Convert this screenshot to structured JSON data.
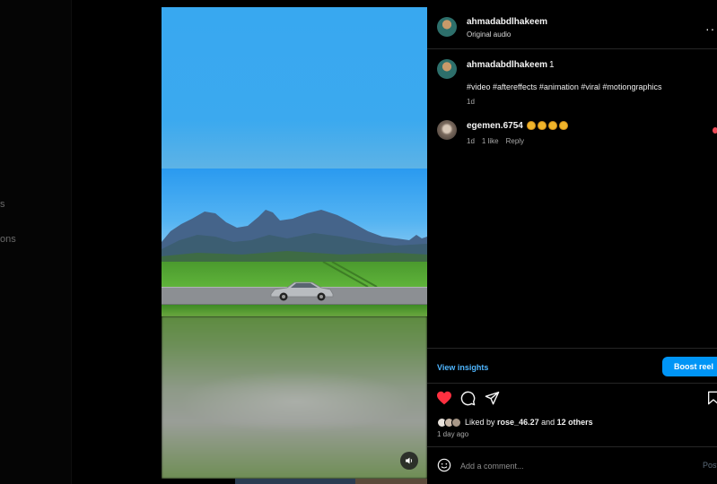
{
  "background": {
    "sidebar_fragments": [
      "s",
      "ons"
    ]
  },
  "video": {
    "mute_icon": "speaker-icon"
  },
  "post": {
    "author": "ahmadabdlhakeem",
    "audio": "Original audio",
    "more_icon": "more-horizontal-icon"
  },
  "caption": {
    "username": "ahmadabdlhakeem",
    "number": "1",
    "text": "#video #aftereffects #animation #viral #motiongraphics",
    "time": "1d"
  },
  "comment": {
    "username": "egemen.6754",
    "emoji": "clapping-hands x4",
    "time": "1d",
    "likes": "1 like",
    "reply": "Reply"
  },
  "insights": {
    "view_label": "View insights",
    "boost_label": "Boost reel",
    "accent": "#0095f6"
  },
  "actions": {
    "liked_icon": "heart-filled-icon",
    "comment_icon": "comment-icon",
    "share_icon": "share-icon",
    "save_icon": "bookmark-icon",
    "heart_color": "#ff3040"
  },
  "likes": {
    "prefix": "Liked by",
    "user": "rose_46.27",
    "and": "and",
    "others": "12 others",
    "time": "1 day ago"
  },
  "composer": {
    "placeholder": "Add a comment...",
    "post_label": "Post"
  }
}
